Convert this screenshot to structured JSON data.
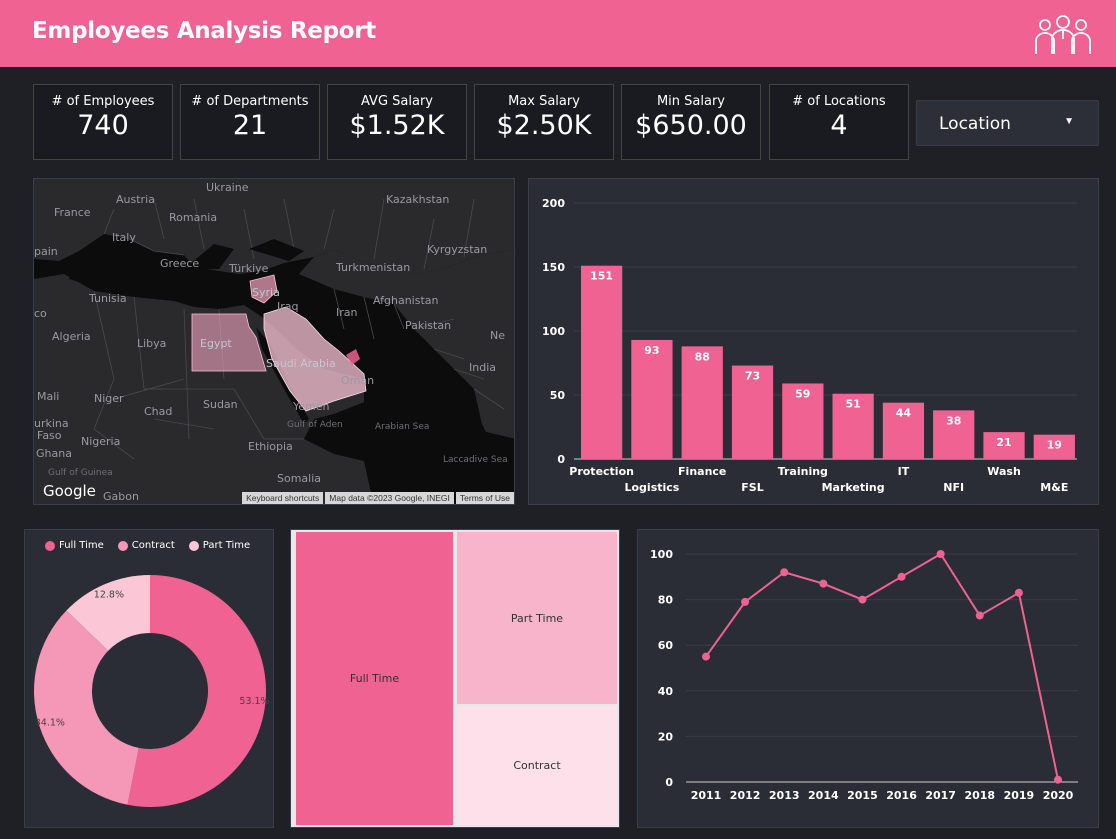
{
  "header": {
    "title": "Employees Analysis Report",
    "icon": "people-group-icon"
  },
  "kpis": [
    {
      "label": "# of Employees",
      "value": "740"
    },
    {
      "label": "# of Departments",
      "value": "21"
    },
    {
      "label": "AVG Salary",
      "value": "$1.52K"
    },
    {
      "label": "Max Salary",
      "value": "$2.50K"
    },
    {
      "label": "Min Salary",
      "value": "$650.00"
    },
    {
      "label": "# of Locations",
      "value": "4"
    }
  ],
  "filter": {
    "label": "Location",
    "icon": "caret-down-icon"
  },
  "map": {
    "labels": [
      "Ukraine",
      "Kazakhstan",
      "France",
      "Austria",
      "Romania",
      "Italy",
      "Kyrgyzstan",
      "pain",
      "Greece",
      "Türkiye",
      "Turkmenistan",
      "Tunisia",
      "Syria",
      "Afghanistan",
      "Iraq",
      "Iran",
      "co",
      "Algeria",
      "Libya",
      "Egypt",
      "Pakistan",
      "Ne",
      "Saudi Arabia",
      "Oman",
      "India",
      "Mali",
      "Niger",
      "Chad",
      "Sudan",
      "Yemen",
      "urkina",
      "Faso",
      "Nigeria",
      "Gulf of Aden",
      "Arabian Sea",
      "Ethiopia",
      "Ghana",
      "Somalia",
      "Gulf of Guinea",
      "Laccadive Sea",
      "Gabon"
    ],
    "highlighted": [
      "Egypt",
      "Saudi Arabia",
      "Syria",
      "UAE"
    ],
    "logo": "Google",
    "attribution": [
      "Keyboard shortcuts",
      "Map data ©2023 Google, INEGI",
      "Terms of Use"
    ]
  },
  "chart_data": [
    {
      "type": "bar",
      "categories": [
        "Protection",
        "Logistics",
        "Finance",
        "FSL",
        "Training",
        "Marketing",
        "IT",
        "NFI",
        "Wash",
        "M&E"
      ],
      "values": [
        151,
        93,
        88,
        73,
        59,
        51,
        44,
        38,
        21,
        19
      ],
      "ylim": [
        0,
        200
      ],
      "yticks": [
        0,
        50,
        100,
        150,
        200
      ],
      "color": "#f06292",
      "grid": true
    },
    {
      "type": "pie",
      "donut": true,
      "labels": [
        "Full Time",
        "Contract",
        "Part Time"
      ],
      "values": [
        53.1,
        34.1,
        12.8
      ],
      "value_labels": [
        "53.1%",
        "34.1%",
        "12.8%"
      ],
      "colors": [
        "#f06292",
        "#f597b7",
        "#fbc6d6"
      ],
      "legend_position": "top"
    },
    {
      "type": "treemap",
      "labels": [
        "Full Time",
        "Part Time",
        "Contract"
      ],
      "values": [
        53.1,
        12.8,
        34.1
      ],
      "colors": [
        "#f06292",
        "#f8b4cb",
        "#fde0e9"
      ]
    },
    {
      "type": "line",
      "x": [
        "2011",
        "2012",
        "2013",
        "2014",
        "2015",
        "2016",
        "2017",
        "2018",
        "2019",
        "2020"
      ],
      "values": [
        55,
        79,
        92,
        87,
        80,
        90,
        100,
        73,
        83,
        1
      ],
      "ylim": [
        0,
        100
      ],
      "yticks": [
        0,
        20,
        40,
        60,
        80,
        100
      ],
      "color": "#f06292",
      "grid": true
    }
  ]
}
